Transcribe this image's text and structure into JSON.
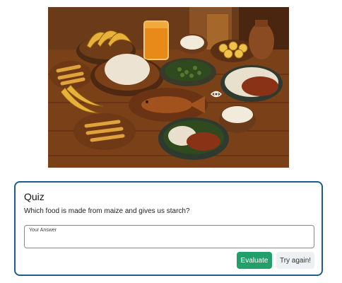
{
  "image": {
    "name": "food-illustration",
    "icon": "eye-icon"
  },
  "quiz": {
    "title": "Quiz",
    "question": "Which food is made from maize and gives us starch?",
    "answer_label": "Your Answer",
    "answer_value": "",
    "evaluate_label": "Evaluate",
    "retry_label": "Try again!"
  },
  "colors": {
    "card_border": "#1f5e88",
    "evaluate_bg": "#22a06b",
    "retry_bg": "#eef1f3"
  }
}
